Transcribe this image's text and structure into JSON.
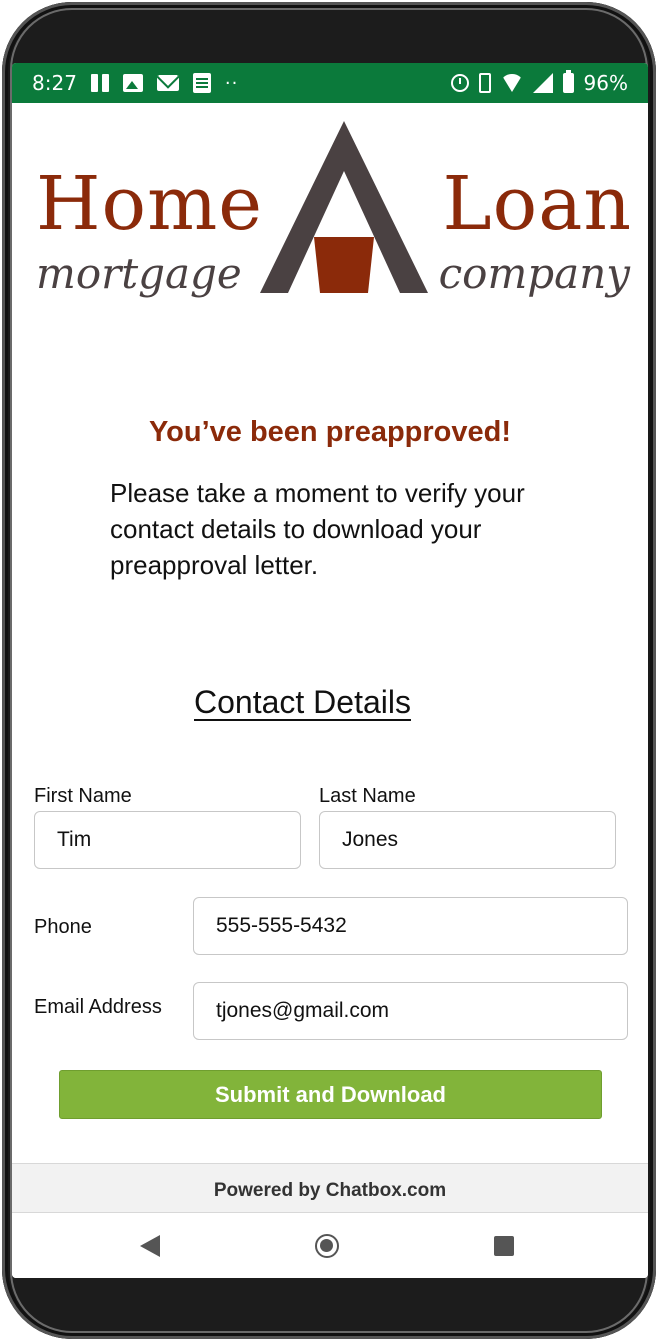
{
  "status_bar": {
    "time": "8:27",
    "battery_percent": "96%",
    "left_icons": [
      "pause-icon",
      "image-icon",
      "mail-icon",
      "document-icon",
      "more-dots-icon"
    ],
    "right_icons": [
      "alarm-icon",
      "vibrate-icon",
      "wifi-icon",
      "signal-icon",
      "battery-charging-icon"
    ],
    "background_color": "#0b7a3b"
  },
  "logo": {
    "word_left_top": "Home",
    "word_right_top": "Loan",
    "word_left_bottom": "mortgage",
    "word_right_bottom": "company",
    "brand_color": "#8b2a0a",
    "secondary_color": "#4a4142"
  },
  "headline": "You’ve been preapproved!",
  "intro_text": "Please take a moment to verify your contact details to download your preapproval letter.",
  "form": {
    "section_title": "Contact Details",
    "first_name": {
      "label": "First Name",
      "value": "Tim"
    },
    "last_name": {
      "label": "Last Name",
      "value": "Jones"
    },
    "phone": {
      "label": "Phone",
      "value": "555-555-5432"
    },
    "email": {
      "label": "Email Address",
      "value": "tjones@gmail.com"
    },
    "submit_label": "Submit and Download",
    "submit_color": "#82b43a"
  },
  "footer": {
    "powered_by": "Powered by Chatbox.com"
  },
  "nav_bar": {
    "icons": [
      "back-icon",
      "home-icon",
      "recents-icon"
    ]
  }
}
